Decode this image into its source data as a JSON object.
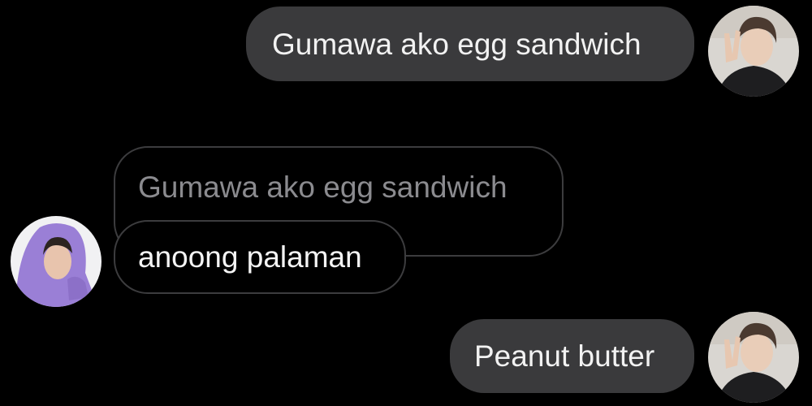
{
  "conversation": {
    "messages": [
      {
        "sender": "me",
        "text": "Gumawa ako egg sandwich"
      },
      {
        "sender": "friend",
        "reply_to": "Gumawa ako egg sandwich",
        "text": "anoong palaman"
      },
      {
        "sender": "me",
        "text": "Peanut butter"
      }
    ]
  },
  "colors": {
    "background": "#000000",
    "sent_bubble": "#3a3a3c",
    "received_border": "#3c3c3e",
    "quoted_text": "#8b8b8f",
    "message_text": "#f2f2f2",
    "friend_hoodie": "#9a7fd6"
  }
}
